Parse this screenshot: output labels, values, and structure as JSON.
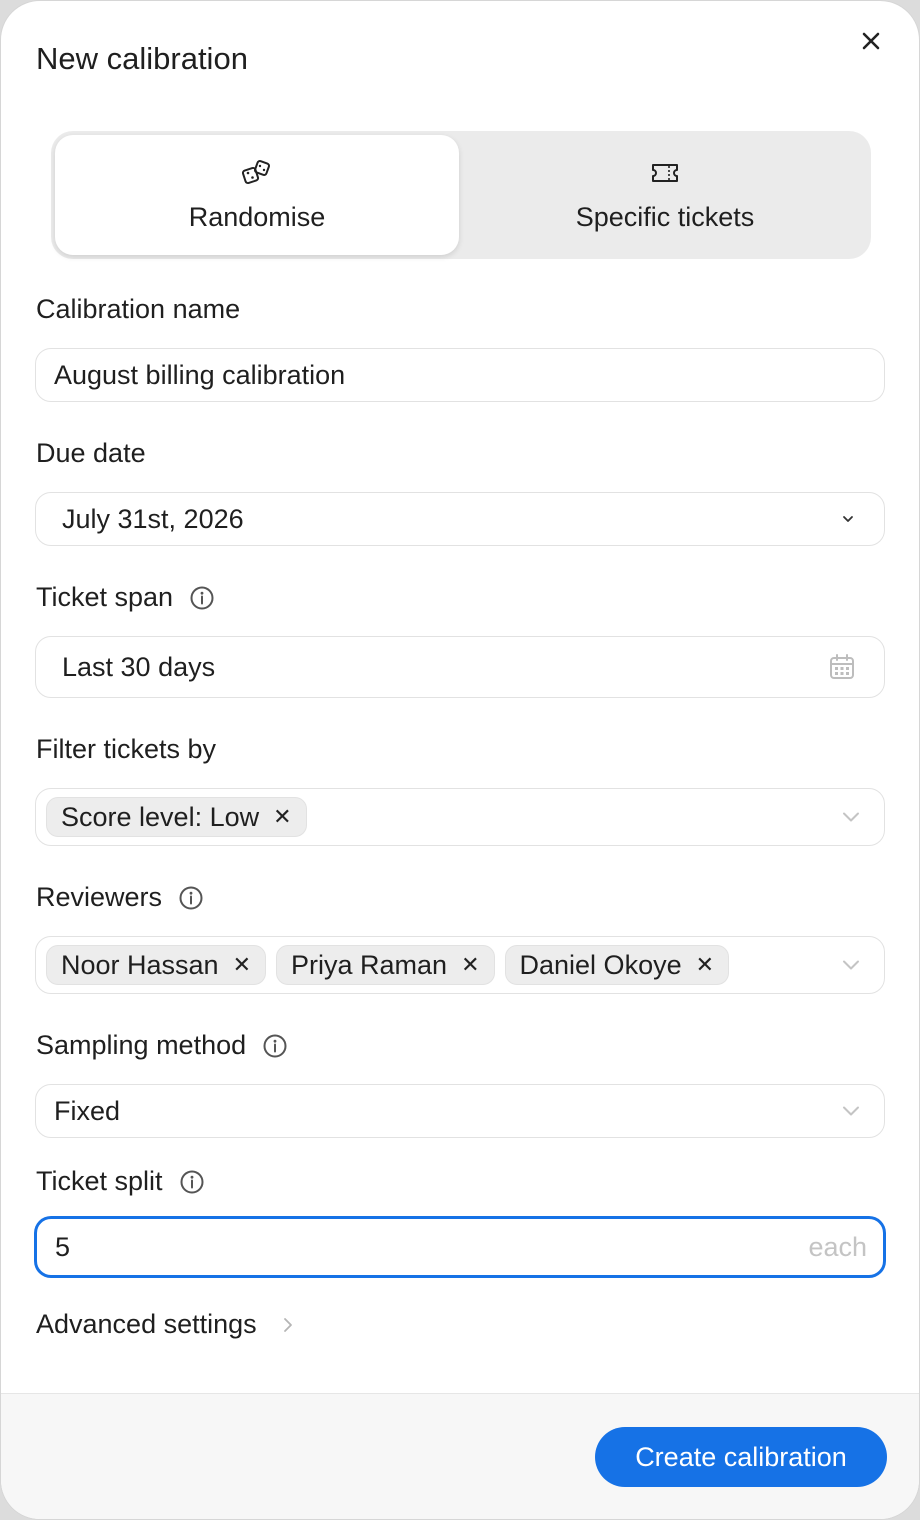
{
  "dialog": {
    "title": "New calibration",
    "accent_color": "#1672e6"
  },
  "mode_toggle": {
    "options": [
      {
        "label": "Randomise",
        "icon": "dice-icon",
        "selected": true
      },
      {
        "label": "Specific tickets",
        "icon": "ticket-icon",
        "selected": false
      }
    ]
  },
  "fields": {
    "calibration_name": {
      "label": "Calibration name",
      "value": "August billing calibration"
    },
    "due_date": {
      "label": "Due date",
      "value": "July 31st, 2026"
    },
    "ticket_span": {
      "label": "Ticket span",
      "value": "Last 30 days"
    },
    "filter_tickets": {
      "label": "Filter tickets by",
      "chips": [
        "Score level: Low"
      ]
    },
    "reviewers": {
      "label": "Reviewers",
      "chips": [
        "Noor Hassan",
        "Priya Raman",
        "Daniel Okoye"
      ]
    },
    "sampling_method": {
      "label": "Sampling method",
      "value": "Fixed"
    },
    "ticket_split": {
      "label": "Ticket split",
      "value": "5",
      "suffix": "each"
    }
  },
  "advanced_settings": {
    "label": "Advanced settings"
  },
  "footer": {
    "create_label": "Create calibration"
  }
}
